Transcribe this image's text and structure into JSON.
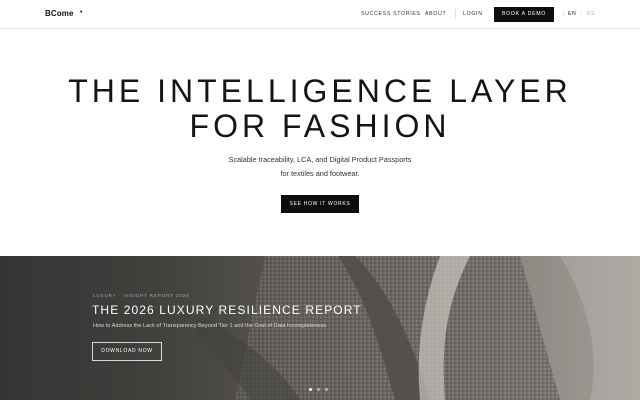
{
  "header": {
    "logo": "BCome",
    "logo_mark": "•",
    "nav": {
      "success_stories": "SUCCESS STORIES",
      "about": "ABOUT",
      "login": "LOGIN"
    },
    "cta_label": "BOOK A DEMO",
    "languages": {
      "active": "EN",
      "divider": "/",
      "other": "ES"
    }
  },
  "hero": {
    "title_line_1": "THE INTELLIGENCE LAYER",
    "title_line_2": "FOR FASHION",
    "subtitle_line_1": "Scalable traceability, LCA, and Digital Product Passports",
    "subtitle_line_2": "for textiles and footwear.",
    "cta_label": "SEE HOW IT WORKS"
  },
  "banner": {
    "eyebrow": "LUXURY · INSIGHT REPORT 2026",
    "title": "THE 2026 LUXURY RESILIENCE REPORT",
    "subtitle": "How to Address the Lack of Transparency Beyond Tier 1 and the Cost of Data Incompleteness",
    "cta_label": "DOWNLOAD NOW",
    "carousel": {
      "slides": 3,
      "active_index": 0
    }
  },
  "colors": {
    "brand_black": "#0d0d0d",
    "background": "#ffffff",
    "banner_dark": "#3f3e3c",
    "banner_light": "#a39f99"
  }
}
